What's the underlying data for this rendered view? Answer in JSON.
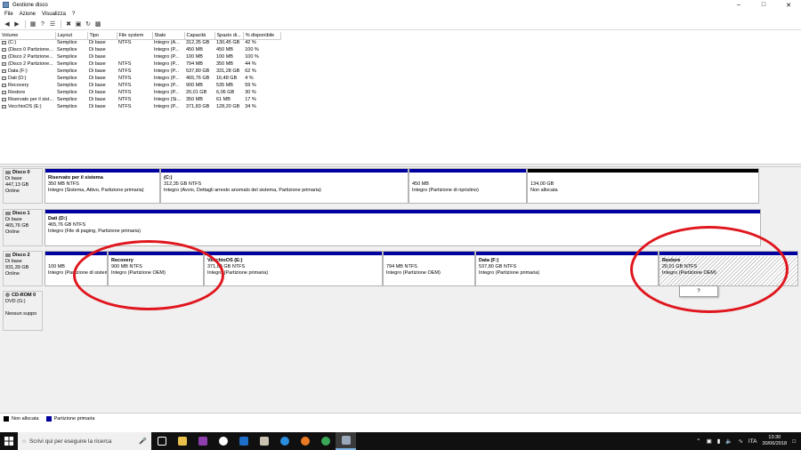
{
  "window": {
    "title": "Gestione disco",
    "min": "–",
    "max": "□",
    "close": "✕"
  },
  "menu": [
    "File",
    "Azione",
    "Visualizza",
    "?"
  ],
  "columns": [
    "Volume",
    "Layout",
    "Tipo",
    "File system",
    "Stato",
    "Capacità",
    "Spazio di...",
    "% disponibile"
  ],
  "volumes": [
    [
      "(C:)",
      "Semplice",
      "Di base",
      "NTFS",
      "Integro (A...",
      "312,35 GB",
      "130,45 GB",
      "42 %"
    ],
    [
      "(Disco 0 Partizione...",
      "Semplice",
      "Di base",
      "",
      "Integro (P...",
      "450 MB",
      "450 MB",
      "100 %"
    ],
    [
      "(Disco 2 Partizione...",
      "Semplice",
      "Di base",
      "",
      "Integro (P...",
      "100 MB",
      "100 MB",
      "100 %"
    ],
    [
      "(Disco 2 Partizione...",
      "Semplice",
      "Di base",
      "NTFS",
      "Integro (P...",
      "794 MB",
      "350 MB",
      "44 %"
    ],
    [
      "Data (F:)",
      "Semplice",
      "Di base",
      "NTFS",
      "Integro (P...",
      "537,80 GB",
      "331,28 GB",
      "62 %"
    ],
    [
      "Dati (D:)",
      "Semplice",
      "Di base",
      "NTFS",
      "Integro (P...",
      "465,76 GB",
      "16,48 GB",
      "4 %"
    ],
    [
      "Recovery",
      "Semplice",
      "Di base",
      "NTFS",
      "Integro (P...",
      "900 MB",
      "535 MB",
      "59 %"
    ],
    [
      "Restore",
      "Semplice",
      "Di base",
      "NTFS",
      "Integro (P...",
      "20,01 GB",
      "6,06 GB",
      "30 %"
    ],
    [
      "Riservato per il sist...",
      "Semplice",
      "Di base",
      "NTFS",
      "Integro (Si...",
      "350 MB",
      "61 MB",
      "17 %"
    ],
    [
      "VecchioOS (E:)",
      "Semplice",
      "Di base",
      "NTFS",
      "Integro (P...",
      "371,83 GB",
      "128,20 GB",
      "34 %"
    ]
  ],
  "disk0": {
    "name": "Disco 0",
    "type": "Di base",
    "size": "447,13 GB",
    "status": "Online",
    "p1": {
      "name": "Riservato per il sistema",
      "size": "350 MB NTFS",
      "status": "Integro (Sistema, Attivo, Partizione primaria)"
    },
    "p2": {
      "name": "(C:)",
      "size": "312,35 GB NTFS",
      "status": "Integro (Avvio, Dettagli arresto anomalo del sistema, Partizione primaria)"
    },
    "p3": {
      "size": "450 MB",
      "status": "Integro (Partizione di ripristino)"
    },
    "p4": {
      "size": "134,00 GB",
      "status": "Non allocata"
    }
  },
  "disk1": {
    "name": "Disco 1",
    "type": "Di base",
    "size": "465,76 GB",
    "status": "Online",
    "p1": {
      "name": "Dati (D:)",
      "size": "465,76 GB NTFS",
      "status": "Integro (File di paging, Partizione primaria)"
    }
  },
  "disk2": {
    "name": "Disco 2",
    "type": "Di base",
    "size": "931,39 GB",
    "status": "Online",
    "p1": {
      "size": "100 MB",
      "status": "Integro (Partizione di sistema)"
    },
    "p2": {
      "name": "Recovery",
      "size": "900 MB NTFS",
      "status": "Integro (Partizione OEM)"
    },
    "p3": {
      "name": "VecchioOS (E:)",
      "size": "371,83 GB NTFS",
      "status": "Integro (Partizione primaria)"
    },
    "p4": {
      "size": "794 MB NTFS",
      "status": "Integro (Partizione OEM)"
    },
    "p5": {
      "name": "Data (F:)",
      "size": "537,80 GB NTFS",
      "status": "Integro (Partizione primaria)"
    },
    "p6": {
      "name": "Restore",
      "size": "20,01 GB NTFS",
      "status": "Integro (Partizione OEM)"
    }
  },
  "cdrom": {
    "name": "CD-ROM 0",
    "type": "DVD (G:)",
    "status": "Nessun suppo"
  },
  "tooltip": "?",
  "legend": {
    "unallocated": "Non allocata",
    "primary": "Partizione primaria"
  },
  "colors": {
    "primary": "#0000a0",
    "unallocated": "#000000",
    "annotation": "#e0161e"
  },
  "taskbar": {
    "search": "Scrivi qui per eseguire la ricerca",
    "lang": "ITA",
    "time": "13:30",
    "date": "30/06/2018"
  }
}
